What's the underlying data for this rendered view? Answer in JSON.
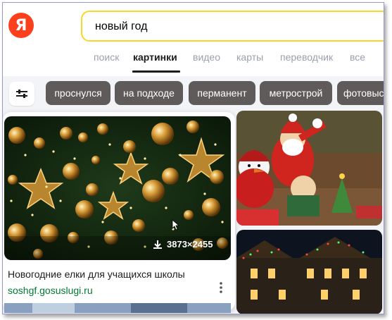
{
  "logo": {
    "text": "Я",
    "color": "#fc3f1d"
  },
  "search": {
    "value": "новый год",
    "border_color": "#fed42b"
  },
  "tabs": [
    {
      "label": "поиск",
      "active": false
    },
    {
      "label": "картинки",
      "active": true
    },
    {
      "label": "видео",
      "active": false
    },
    {
      "label": "карты",
      "active": false
    },
    {
      "label": "переводчик",
      "active": false
    },
    {
      "label": "все",
      "active": false
    }
  ],
  "filter_button": {
    "icon": "sliders-icon"
  },
  "chips": [
    "проснулся",
    "на подходе",
    "перманент",
    "метрострой",
    "фотовыс"
  ],
  "result_card": {
    "size": "3873×2455",
    "download_icon": "download-icon",
    "title": "Новогодние елки для учащихся школы",
    "source": "soshgf.gosuslugi.ru",
    "more_icon": "more-vertical-icon",
    "source_color": "#007a32"
  }
}
